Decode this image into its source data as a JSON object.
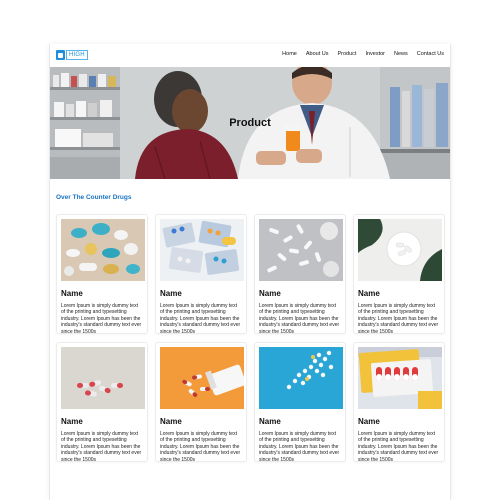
{
  "brand": {
    "logo_text": "HIGH"
  },
  "nav": {
    "items": [
      "Home",
      "About Us",
      "Product",
      "Investor",
      "News",
      "Contact Us"
    ]
  },
  "hero": {
    "title": "Product"
  },
  "section": {
    "title": "Over The Counter Drugs"
  },
  "products": [
    {
      "name": "Name",
      "description": "Lorem Ipsum is simply dummy text of the printing and typesetting industry. Lorem Ipsum has been the industry's standard dummy text ever since the 1500s",
      "image": "blue-capsules-pills"
    },
    {
      "name": "Name",
      "description": "Lorem Ipsum is simply dummy text of the printing and typesetting industry. Lorem Ipsum has been the industry's standard dummy text ever since the 1500s",
      "image": "blister-packs"
    },
    {
      "name": "Name",
      "description": "Lorem Ipsum is simply dummy text of the printing and typesetting industry. Lorem Ipsum has been the industry's standard dummy text ever since the 1500s",
      "image": "white-pills-grey"
    },
    {
      "name": "Name",
      "description": "Lorem Ipsum is simply dummy text of the printing and typesetting industry. Lorem Ipsum has been the industry's standard dummy text ever since the 1500s",
      "image": "bowl-pills-leaves"
    },
    {
      "name": "Name",
      "description": "Lorem Ipsum is simply dummy text of the printing and typesetting industry. Lorem Ipsum has been the industry's standard dummy text ever since the 1500s",
      "image": "red-white-capsules"
    },
    {
      "name": "Name",
      "description": "Lorem Ipsum is simply dummy text of the printing and typesetting industry. Lorem Ipsum has been the industry's standard dummy text ever since the 1500s",
      "image": "orange-pill-bottle"
    },
    {
      "name": "Name",
      "description": "Lorem Ipsum is simply dummy text of the printing and typesetting industry. Lorem Ipsum has been the industry's standard dummy text ever since the 1500s",
      "image": "pills-on-blue"
    },
    {
      "name": "Name",
      "description": "Lorem Ipsum is simply dummy text of the printing and typesetting industry. Lorem Ipsum has been the industry's standard dummy text ever since the 1500s",
      "image": "capsules-in-yellow-box"
    }
  ],
  "colors": {
    "accent": "#1a74c2",
    "logo": "#1e8fd8"
  }
}
